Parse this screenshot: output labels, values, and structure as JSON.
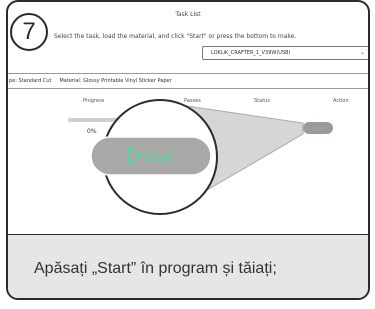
{
  "step_number": "7",
  "window": {
    "title": "Task List"
  },
  "instruction": "Select the task, load the material, and click \"Start\" or press the bottom to make.",
  "device_select": {
    "value": "LOKLiK_CRAFTER_1_V39W(USB)"
  },
  "info_bar": {
    "cut_type": "pe: Standard Cut",
    "material": "Material: Glossy Printable Vinyl Sticker Paper"
  },
  "table": {
    "headers": [
      "Progress",
      "Passes",
      "Status",
      "Action"
    ],
    "row": {
      "progress_label": "0%",
      "progress": 0,
      "action_label": "Start"
    }
  },
  "zoom": {
    "start_label": "Start"
  },
  "caption": "Apăsați „Start” în program și tăiați;",
  "colors": {
    "start_icon": "#4fe09a",
    "button_gray": "#9a9a9a"
  }
}
